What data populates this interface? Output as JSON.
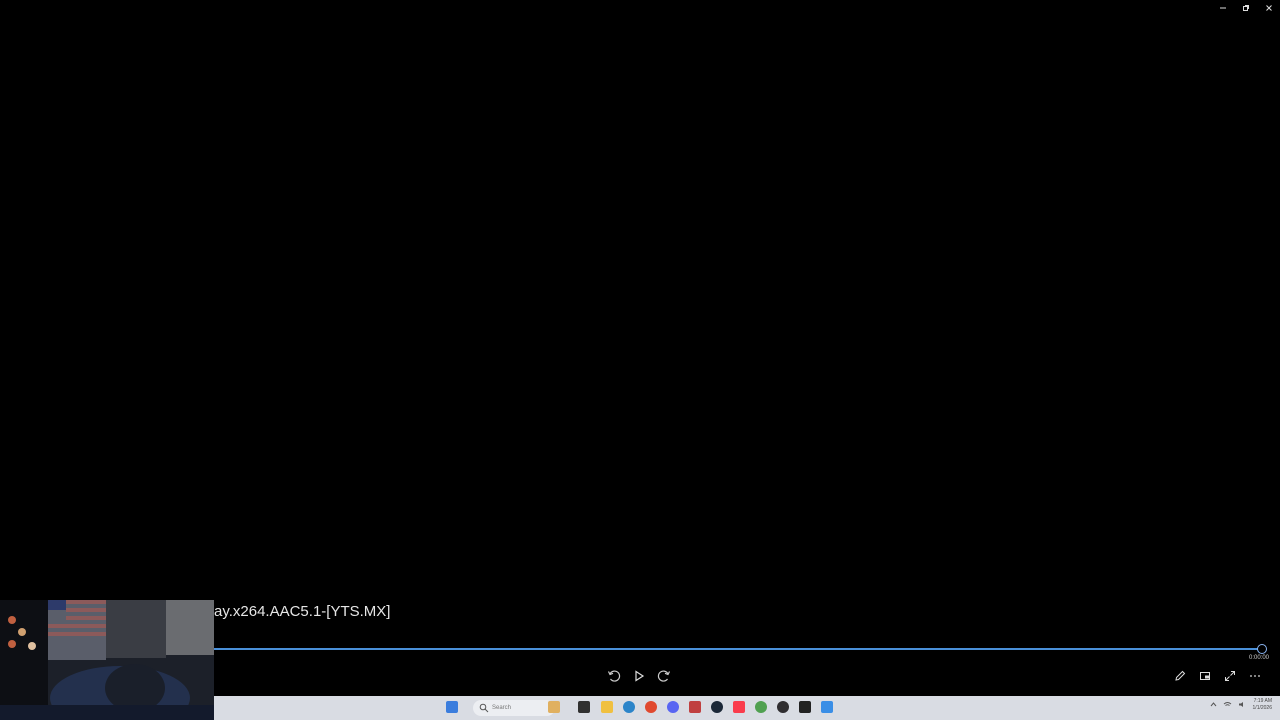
{
  "player": {
    "title": "ay.x264.AAC5.1-[YTS.MX]",
    "elapsed": "0:00:00",
    "progress": 1.0
  },
  "window_controls": [
    "minimize-icon",
    "restore-icon",
    "close-icon"
  ],
  "transport": [
    "skip-back-icon",
    "play-icon",
    "skip-forward-icon"
  ],
  "right_controls": [
    "edit-icon",
    "mini-view-icon",
    "fullscreen-icon",
    "more-icon"
  ],
  "taskbar": {
    "search_placeholder": "Search",
    "clock_time": "7:19 AM",
    "clock_date": "1/1/2026",
    "apps": [
      "start-icon",
      "widgets-icon",
      "terminal-icon",
      "file-explorer-icon",
      "edge-icon",
      "chrome-icon",
      "discord-icon",
      "game-icon",
      "steam-icon",
      "music-icon",
      "app-icon",
      "obs-icon",
      "media-icon",
      "media-player-icon"
    ]
  },
  "colors": {
    "accent": "#4a90d9",
    "background": "#000000",
    "taskbar": "#d9dce3"
  }
}
